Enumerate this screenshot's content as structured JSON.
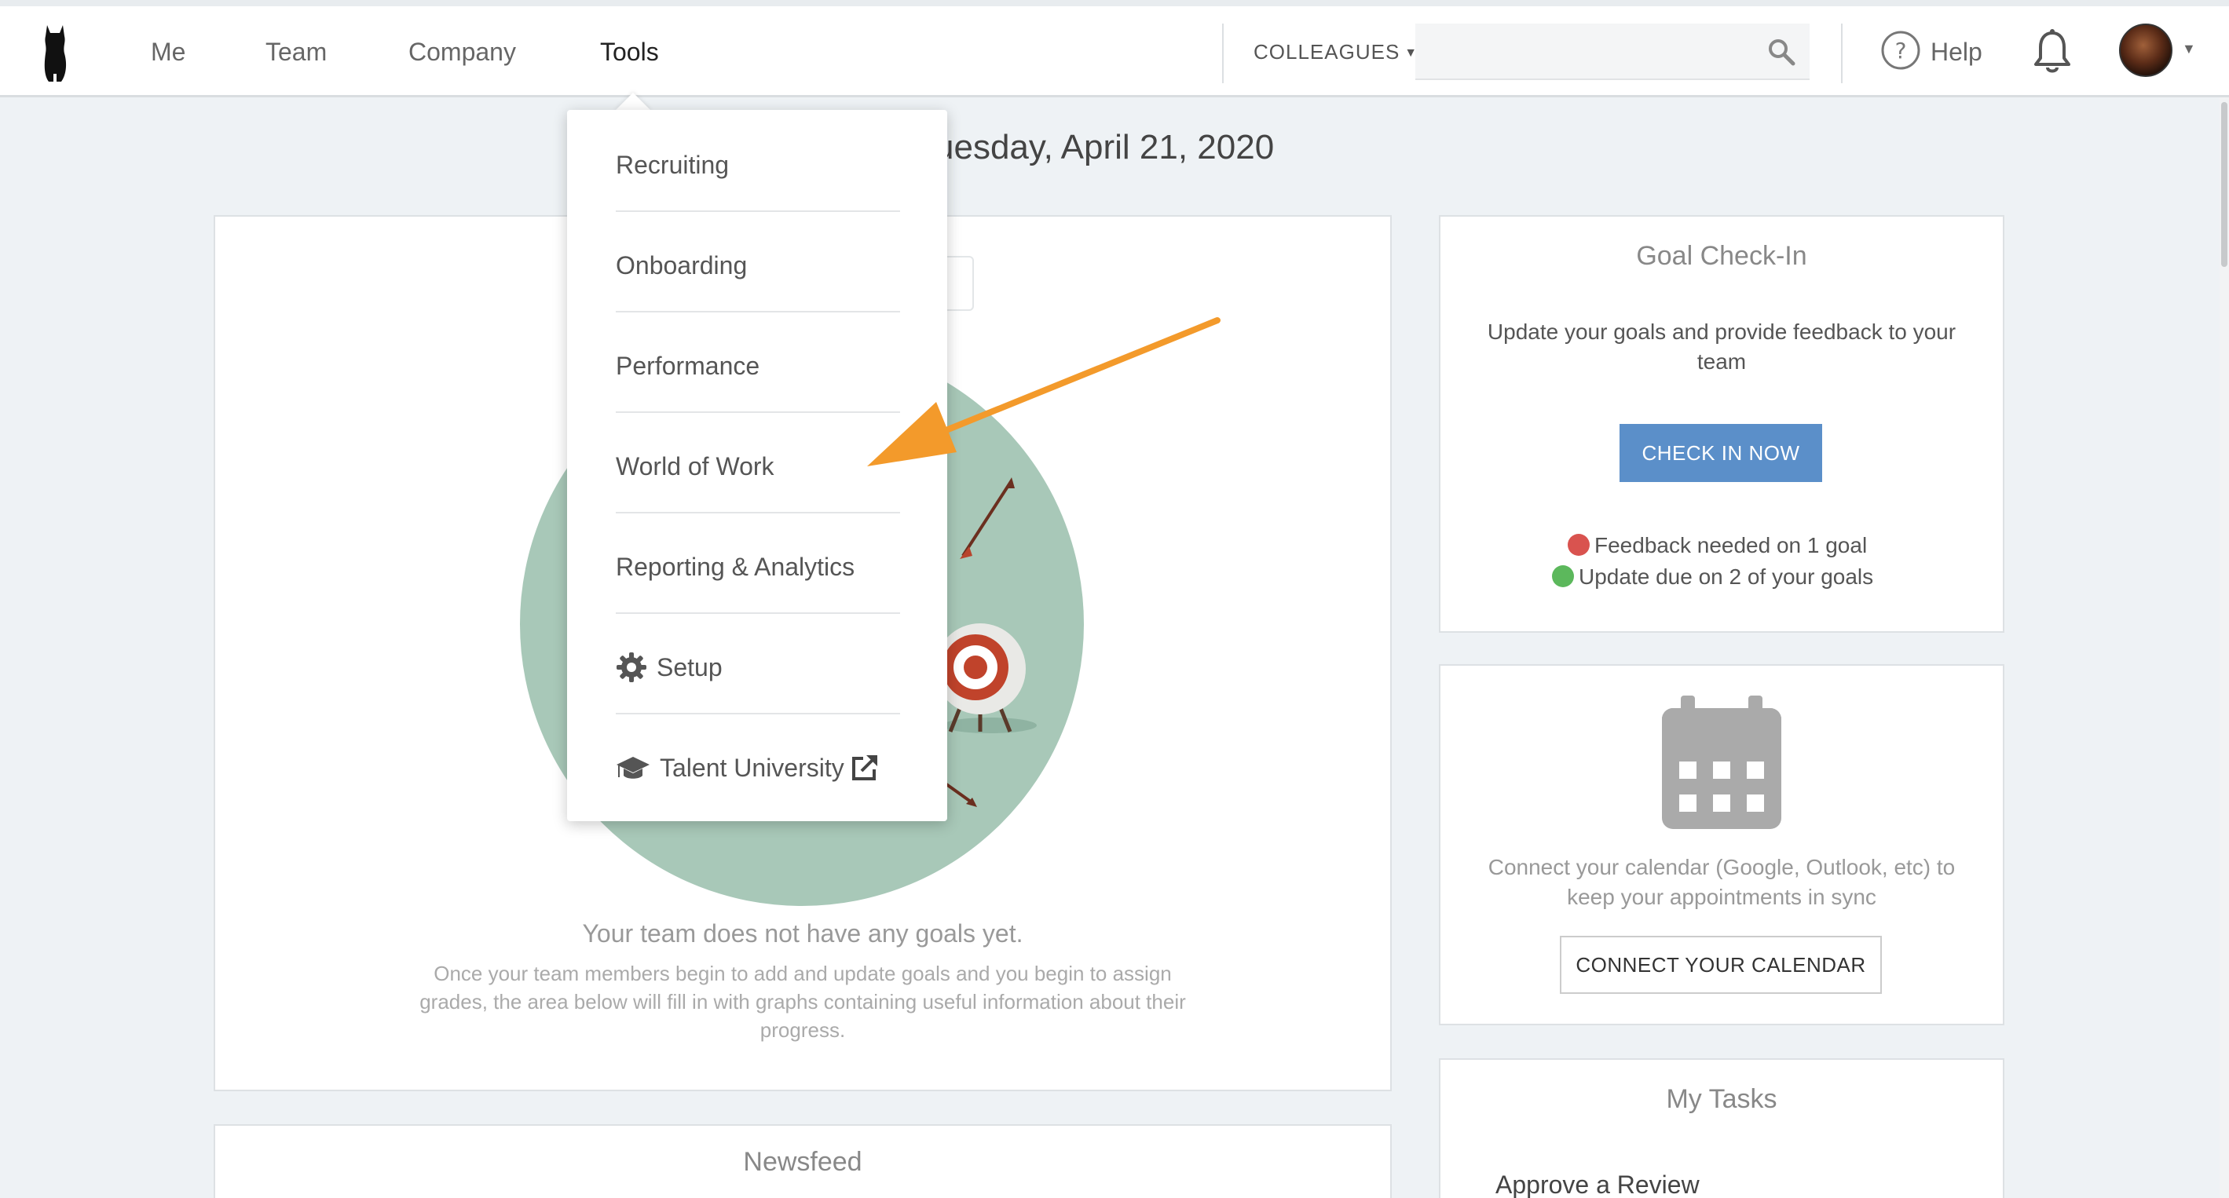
{
  "nav": {
    "items": [
      {
        "label": "Me"
      },
      {
        "label": "Team"
      },
      {
        "label": "Company"
      },
      {
        "label": "Tools"
      }
    ],
    "colleagues_label": "COLLEAGUES",
    "search_placeholder": "",
    "help_label": "Help"
  },
  "page": {
    "date": "uesday, April 21, 2020"
  },
  "tools_menu": {
    "items": [
      {
        "label": "Recruiting"
      },
      {
        "label": "Onboarding"
      },
      {
        "label": "Performance"
      },
      {
        "label": "World of Work"
      },
      {
        "label": "Reporting & Analytics"
      },
      {
        "label": "Setup",
        "icon": "gear-icon"
      },
      {
        "label": "Talent University",
        "icon": "graduation-cap-icon",
        "trailing_icon": "external-link-icon"
      }
    ]
  },
  "team_goals": {
    "empty_title": "Your team does not have any goals yet.",
    "empty_desc": "Once your team members begin to add and update goals and you begin to assign grades, the area below will fill in with graphs containing useful information about their progress."
  },
  "newsfeed": {
    "title": "Newsfeed"
  },
  "goal_checkin": {
    "title": "Goal Check-In",
    "desc": "Update your goals and provide feedback to your team",
    "button": "CHECK IN NOW",
    "status": [
      {
        "text": "Feedback needed on 1 goal",
        "color": "#d9534f"
      },
      {
        "text": "Update due on 2 of your goals",
        "color": "#5cb85c"
      }
    ]
  },
  "calendar": {
    "desc": "Connect your calendar (Google, Outlook, etc) to keep your appointments in sync",
    "button": "CONNECT YOUR CALENDAR"
  },
  "tasks": {
    "title": "My Tasks",
    "items": [
      {
        "label": "Approve a Review"
      }
    ]
  },
  "colors": {
    "primary_button": "#5b8fc9",
    "annotation_arrow": "#f39a2b",
    "illustration_circle": "#a8c8b8"
  }
}
